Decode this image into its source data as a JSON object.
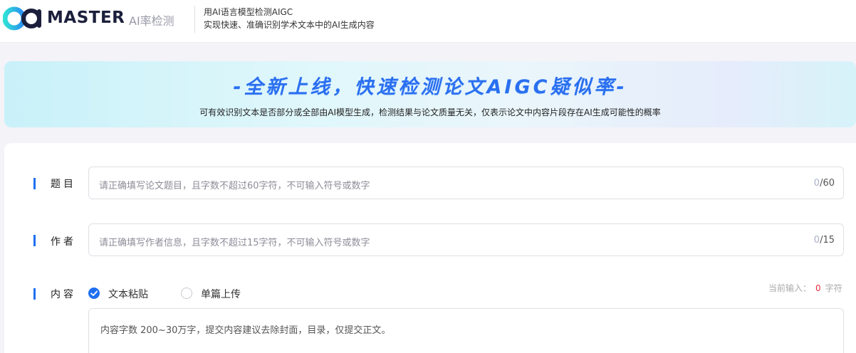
{
  "header": {
    "brand": "MASTER",
    "brand_sub": "AI率检测",
    "tagline_line1": "用AI语言模型检测AIGC",
    "tagline_line2": "实现快速、准确识别学术文本中的AI生成内容",
    "logo_icon": "master-logo-icon"
  },
  "banner": {
    "title": "-全新上线，快速检测论文AIGC疑似率-",
    "subtitle": "可有效识别文本是否部分或全部由AI模型生成，检测结果与论文质量无关，仅表示论文中内容片段存在AI生成可能性的概率"
  },
  "form": {
    "title_label": "题目",
    "title_placeholder": "请正确填写论文题目，且字数不超过60字符，不可输入符号或数字",
    "title_count": "0",
    "title_max": "/60",
    "author_label": "作者",
    "author_placeholder": "请正确填写作者信息，且字数不超过15字符，不可输入符号或数字",
    "author_count": "0",
    "author_max": "/15",
    "content_label": "内容",
    "option_paste": "文本粘贴",
    "option_upload": "单篇上传",
    "selected_option": "文本粘贴",
    "counter_prefix": "当前输入：",
    "counter_value": "0",
    "counter_suffix": "字符",
    "content_placeholder": "内容字数 200~30万字，提交内容建议去除封面，目录，仅提交正文。"
  },
  "colors": {
    "accent": "#1e6ff2",
    "counter_red": "#e8313d",
    "banner_title": "#2a6ff0"
  }
}
